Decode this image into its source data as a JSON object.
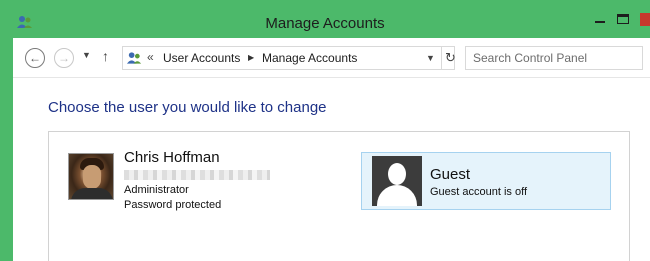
{
  "window": {
    "title": "Manage Accounts",
    "controls": {
      "minimize": "minimize",
      "maximize": "maximize",
      "close": "close"
    },
    "frame_color": "#4cb96a"
  },
  "nav": {
    "back_icon": "back-arrow-icon",
    "forward_icon": "forward-arrow-icon",
    "recent_icon": "chevron-down-icon",
    "up_icon": "up-arrow-icon"
  },
  "address": {
    "overflow": "«",
    "crumbs": [
      "User Accounts",
      "Manage Accounts"
    ],
    "separator_icon": "triangle-right-icon",
    "dropdown_icon": "chevron-down-icon",
    "refresh_icon": "refresh-icon"
  },
  "search": {
    "placeholder": "Search Control Panel"
  },
  "page": {
    "heading": "Choose the user you would like to change"
  },
  "accounts": [
    {
      "name": "Chris Hoffman",
      "role": "Administrator",
      "status": "Password protected",
      "avatar": "user-photo"
    },
    {
      "name": "Guest",
      "status": "Guest account is off",
      "avatar": "generic-user-icon",
      "selected": true,
      "highlight_color": "#e5f3fb"
    }
  ],
  "colors": {
    "heading": "#1e3287",
    "close_button": "#c7382d"
  }
}
